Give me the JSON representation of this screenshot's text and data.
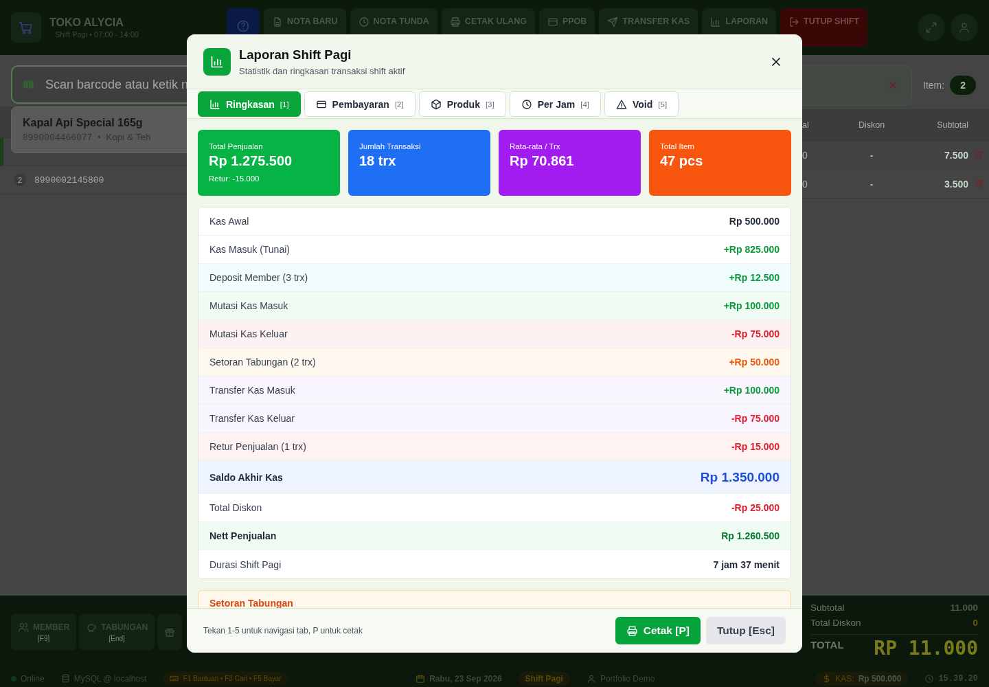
{
  "topbar": {
    "store": "TOKO ALYCIA",
    "shift": "Shift Pagi • 07:00 - 14:00",
    "nav": [
      {
        "kind": "help"
      },
      {
        "kind": "nav",
        "label": "NOTA BARU"
      },
      {
        "kind": "nav",
        "label": "NOTA TUNDA"
      },
      {
        "kind": "nav",
        "label": "CETAK ULANG"
      },
      {
        "kind": "nav",
        "label": "PPOB"
      },
      {
        "kind": "nav",
        "label": "TRANSFER KAS"
      },
      {
        "kind": "nav",
        "label": "LAPORAN"
      },
      {
        "kind": "danger",
        "label": "TUTUP SHIFT"
      }
    ]
  },
  "search": {
    "placeholder": "Scan barcode atau ketik n"
  },
  "suggestion": {
    "name": "Kapal Api Special 165g",
    "code": "8990004466077",
    "separator": "•",
    "category": "Kopi & Teh"
  },
  "item_count": {
    "label": "Item:",
    "value": "2"
  },
  "cart": {
    "columns": [
      "al",
      "Diskon",
      "Subtotal"
    ],
    "rows": [
      {
        "column_1": "0",
        "discount": "-",
        "subtotal": "7.500",
        "selected": true
      },
      {
        "number": "2",
        "barcode": "8990002145800",
        "column_1": "0",
        "discount": "-",
        "subtotal": "3.500",
        "selected": false
      }
    ]
  },
  "bottom_buttons": [
    {
      "kind": "labeled",
      "label": "MEMBER",
      "shortcut": "[F9]"
    },
    {
      "kind": "labeled",
      "label": "TABUNGAN",
      "shortcut": "[End]"
    },
    {
      "kind": "icon"
    }
  ],
  "summary": {
    "subtotal_label": "Subtotal",
    "subtotal": "11.000",
    "discount_label": "Total Diskon",
    "discount": "0",
    "total_label": "TOTAL",
    "total": "RP 11.000"
  },
  "status_bar": {
    "online": "Online",
    "db": "MySQL @ localhost",
    "keys": "F1 Bantuan • F3 Cari • F5 Bayar",
    "date": "Rabu, 23 Sep 2026",
    "shift": "Shift Pagi",
    "user": "Portfolio Demo",
    "kas_label": "KAS:",
    "kas": "Rp 500.000",
    "time": "15.39.20"
  },
  "modal": {
    "title": "Laporan Shift Pagi",
    "subtitle": "Statistik dan ringkasan transaksi shift aktif",
    "tabs": [
      {
        "label": "Ringkasan",
        "key": "[1]",
        "selected": true
      },
      {
        "label": "Pembayaran",
        "key": "[2]",
        "selected": false
      },
      {
        "label": "Produk",
        "key": "[3]",
        "selected": false
      },
      {
        "label": "Per Jam",
        "key": "[4]",
        "selected": false
      },
      {
        "label": "Void",
        "key": "[5]",
        "selected": false
      }
    ],
    "stats": [
      {
        "label": "Total Penjualan",
        "value": "Rp 1.275.500",
        "note": "Retur: -15.000",
        "color": "#06b445"
      },
      {
        "label": "Jumlah Transaksi",
        "value": "18 trx",
        "color": "#1f6ff5"
      },
      {
        "label": "Rata-rata / Trx",
        "value": "Rp 70.861",
        "color": "#a21cf0"
      },
      {
        "label": "Total Item",
        "value": "47 pcs",
        "color": "#f8560e"
      }
    ],
    "rows": [
      {
        "label": "Kas Awal",
        "value": "Rp 500.000",
        "kind": "plain",
        "color": "#ffffff"
      },
      {
        "label": "Kas Masuk (Tunai)",
        "value": "+Rp 825.000",
        "kind": "plus",
        "color": "#ffffff"
      },
      {
        "label": "Deposit Member (3 trx)",
        "value": "+Rp 12.500",
        "kind": "plus",
        "color": "#effcfb"
      },
      {
        "label": "Mutasi Kas Masuk",
        "value": "+Rp 100.000",
        "kind": "plus",
        "color": "#f0fcf3"
      },
      {
        "label": "Mutasi Kas Keluar",
        "value": "-Rp 75.000",
        "kind": "minus",
        "color": "#fef1f1"
      },
      {
        "label": "Setoran Tabungan (2 trx)",
        "value": "+Rp 50.000",
        "kind": "orange",
        "color": "#fff8ef"
      },
      {
        "label": "Transfer Kas Masuk",
        "value": "+Rp 100.000",
        "kind": "plus",
        "color": "#f9f5ff"
      },
      {
        "label": "Transfer Kas Keluar",
        "value": "-Rp 75.000",
        "kind": "minus",
        "color": "#f9f5ff"
      },
      {
        "label": "Retur Penjualan (1 trx)",
        "value": "-Rp 15.000",
        "kind": "minus",
        "color": "#fef3f2"
      },
      {
        "label": "Saldo Akhir Kas",
        "value": "Rp 1.350.000",
        "kind": "total",
        "color": "#eef4ff"
      },
      {
        "label": "Total Diskon",
        "value": "-Rp 25.000",
        "kind": "minus",
        "color": "#ffffff"
      },
      {
        "label": "Nett Penjualan",
        "value": "Rp 1.260.500",
        "kind": "nett",
        "color": "#f0fcf3"
      },
      {
        "label": "Durasi Shift Pagi",
        "value": "7 jam 37 menit",
        "kind": "plain",
        "color": "#ffffff"
      }
    ],
    "section_title": "Setoran Tabungan",
    "hint": "Tekan 1-5 untuk navigasi tab, P untuk cetak",
    "print_button": "Cetak [P]",
    "close_button": "Tutup [Esc]"
  }
}
